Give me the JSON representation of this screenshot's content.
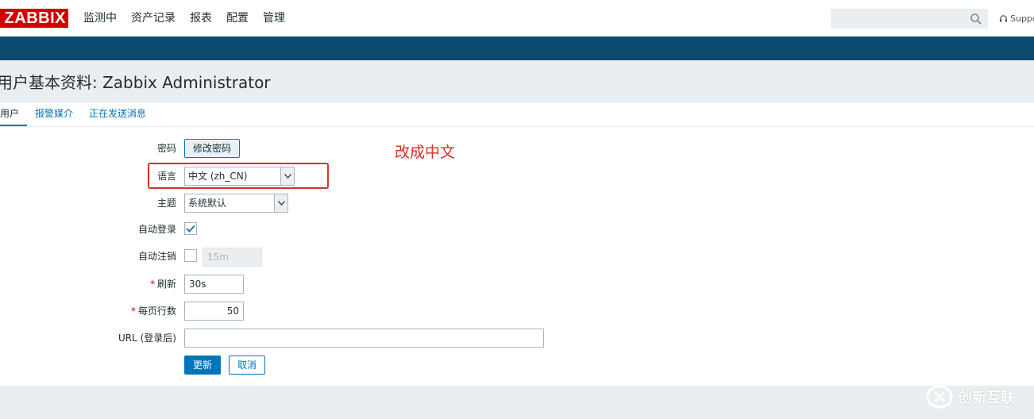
{
  "header": {
    "logo": "ZABBIX",
    "nav": [
      "监测中",
      "资产记录",
      "报表",
      "配置",
      "管理"
    ],
    "search_placeholder": "",
    "support_label": "Support"
  },
  "page": {
    "title": "用户基本资料: Zabbix Administrator"
  },
  "tabs": [
    {
      "label": "用户",
      "active": true
    },
    {
      "label": "报警媒介",
      "active": false
    },
    {
      "label": "正在发送消息",
      "active": false
    }
  ],
  "form": {
    "password": {
      "label": "密码",
      "button": "修改密码"
    },
    "language": {
      "label": "语言",
      "value": "中文 (zh_CN)"
    },
    "theme": {
      "label": "主题",
      "value": "系统默认"
    },
    "autologin": {
      "label": "自动登录",
      "checked": true
    },
    "autologout": {
      "label": "自动注销",
      "checked": false,
      "value": "15m"
    },
    "refresh": {
      "label": "刷新",
      "required_mark": "*",
      "value": "30s"
    },
    "rows_per_page": {
      "label": "每页行数",
      "required_mark": "*",
      "value": "50"
    },
    "url": {
      "label": "URL (登录后)",
      "value": ""
    },
    "buttons": {
      "update": "更新",
      "cancel": "取消"
    }
  },
  "annotation": {
    "text": "改成中文"
  },
  "watermark": {
    "text": "创新互联"
  },
  "colors": {
    "brand_red": "#d40000",
    "nav_bar": "#0b4a6e",
    "accent_blue": "#0275b8",
    "annotation_red": "#d93025"
  }
}
